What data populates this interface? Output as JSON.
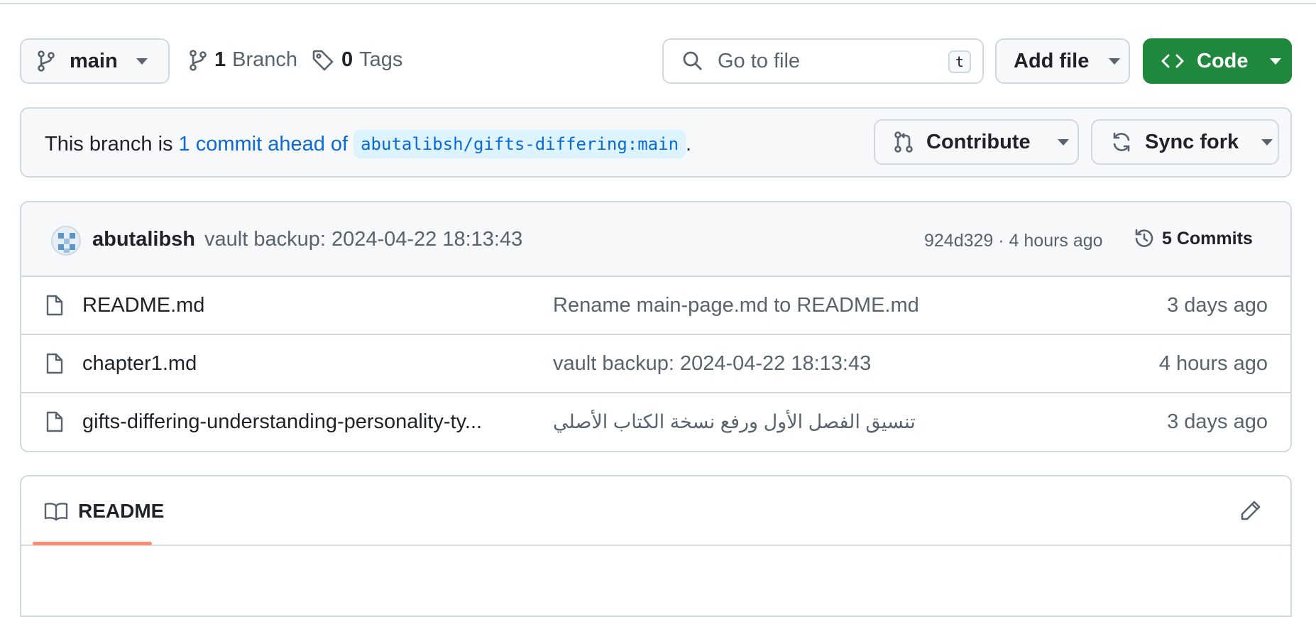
{
  "branch": {
    "name": "main",
    "branch_count": "1",
    "branch_label": "Branch",
    "tag_count": "0",
    "tag_label": "Tags"
  },
  "search": {
    "placeholder": "Go to file",
    "shortcut": "t"
  },
  "toolbar": {
    "add_file": "Add file",
    "code": "Code"
  },
  "fork_banner": {
    "prefix": "This branch is",
    "ahead_link": "1 commit ahead of",
    "upstream_ref": "abutalibsh/gifts-differing:main",
    "suffix": ".",
    "contribute": "Contribute",
    "sync_fork": "Sync fork"
  },
  "latest_commit": {
    "author": "abutalibsh",
    "message": "vault backup: 2024-04-22 18:13:43",
    "sha": "924d329",
    "separator": " · ",
    "age": "4 hours ago",
    "commits_label": "5 Commits"
  },
  "files": [
    {
      "name": "README.md",
      "message": "Rename main-page.md to README.md",
      "age": "3 days ago"
    },
    {
      "name": "chapter1.md",
      "message": "vault backup: 2024-04-22 18:13:43",
      "age": "4 hours ago"
    },
    {
      "name": "gifts-differing-understanding-personality-ty...",
      "message": "تنسيق الفصل الأول ورفع نسخة الكتاب الأصلي",
      "age": "3 days ago"
    }
  ],
  "readme": {
    "tab_label": "README"
  },
  "colors": {
    "accent": "#0969da",
    "code_button": "#1f883d",
    "tab_underline": "#fd8c73",
    "border": "#d1d9e0"
  }
}
